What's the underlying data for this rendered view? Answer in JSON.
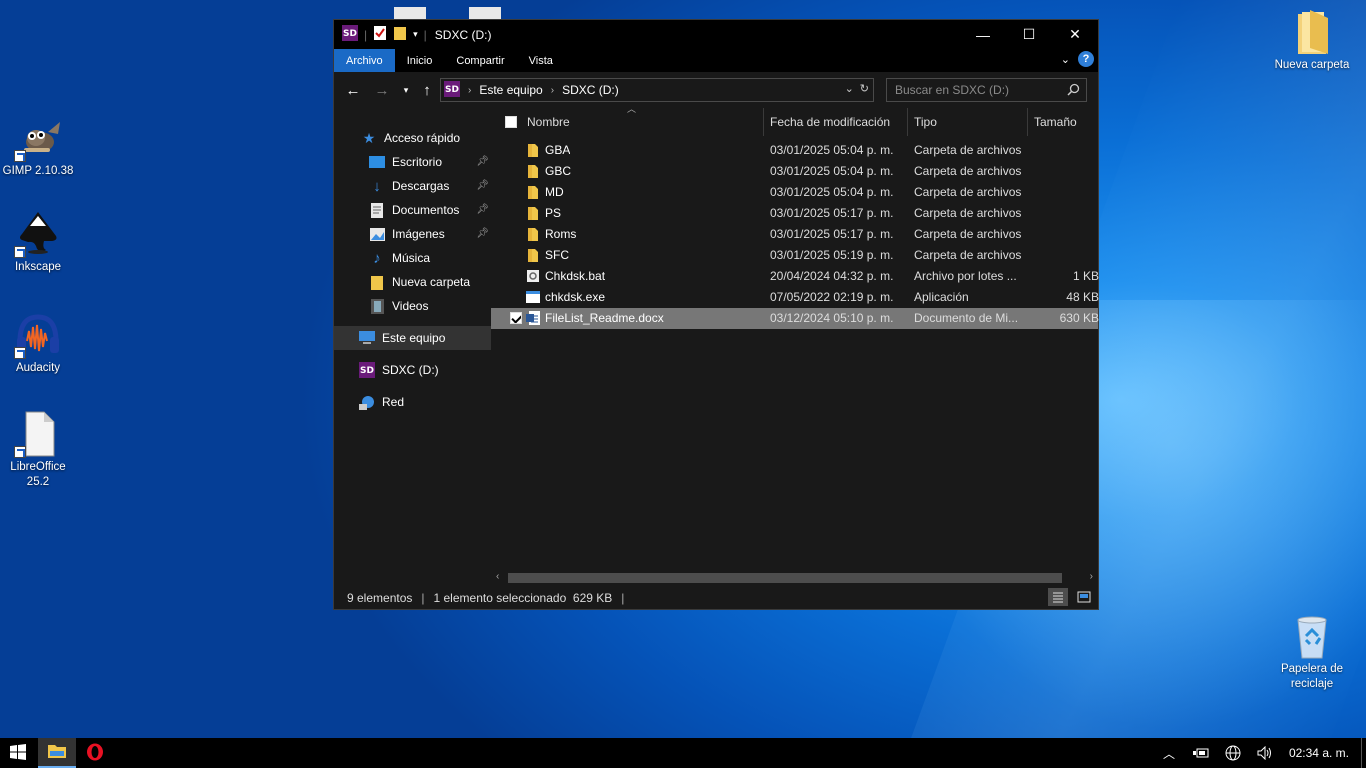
{
  "desktop": {
    "icons": [
      {
        "label": "GIMP 2.10.38",
        "icon": "gimp-icon"
      },
      {
        "label": "Inkscape",
        "icon": "inkscape-icon"
      },
      {
        "label": "Audacity",
        "icon": "audacity-icon"
      },
      {
        "label": "LibreOffice 25.2",
        "icon": "libreoffice-icon"
      },
      {
        "label": "Nueva carpeta",
        "icon": "folder-icon"
      },
      {
        "label": "Papelera de reciclaje",
        "icon": "recycle-bin-icon"
      }
    ]
  },
  "window": {
    "title": "SDXC (D:)",
    "controls": {
      "minimize": "—",
      "maximize": "☐",
      "close": "✕"
    },
    "ribbon_tabs": [
      "Archivo",
      "Inicio",
      "Compartir",
      "Vista"
    ],
    "address": {
      "crumbs": [
        "Este equipo",
        "SDXC (D:)"
      ]
    },
    "search": {
      "placeholder": "Buscar en SDXC (D:)"
    },
    "nav": {
      "quick_access": "Acceso rápido",
      "items": [
        "Escritorio",
        "Descargas",
        "Documentos",
        "Imágenes",
        "Música",
        "Nueva carpeta",
        "Videos"
      ],
      "this_pc": "Este equipo",
      "drive": "SDXC (D:)",
      "network": "Red"
    },
    "columns": {
      "name": "Nombre",
      "date": "Fecha de modificación",
      "type": "Tipo",
      "size": "Tamaño"
    },
    "files": [
      {
        "name": "GBA",
        "date": "03/01/2025 05:04 p. m.",
        "type": "Carpeta de archivos",
        "size": "",
        "icon": "folder-icon"
      },
      {
        "name": "GBC",
        "date": "03/01/2025 05:04 p. m.",
        "type": "Carpeta de archivos",
        "size": "",
        "icon": "folder-icon"
      },
      {
        "name": "MD",
        "date": "03/01/2025 05:04 p. m.",
        "type": "Carpeta de archivos",
        "size": "",
        "icon": "folder-icon"
      },
      {
        "name": "PS",
        "date": "03/01/2025 05:17 p. m.",
        "type": "Carpeta de archivos",
        "size": "",
        "icon": "folder-icon"
      },
      {
        "name": "Roms",
        "date": "03/01/2025 05:17 p. m.",
        "type": "Carpeta de archivos",
        "size": "",
        "icon": "folder-icon"
      },
      {
        "name": "SFC",
        "date": "03/01/2025 05:19 p. m.",
        "type": "Carpeta de archivos",
        "size": "",
        "icon": "folder-icon"
      },
      {
        "name": "Chkdsk.bat",
        "date": "20/04/2024 04:32 p. m.",
        "type": "Archivo por lotes ...",
        "size": "1 KB",
        "icon": "batch-file-icon"
      },
      {
        "name": "chkdsk.exe",
        "date": "07/05/2022 02:19 p. m.",
        "type": "Aplicación",
        "size": "48 KB",
        "icon": "exe-file-icon"
      },
      {
        "name": "FileList_Readme.docx",
        "date": "03/12/2024 05:10 p. m.",
        "type": "Documento de Mi...",
        "size": "630 KB",
        "icon": "word-doc-icon",
        "selected": true
      }
    ],
    "status": {
      "count": "9 elementos",
      "selection": "1 elemento seleccionado  629 KB"
    }
  },
  "taskbar": {
    "clock": "02:34 a. m.",
    "apps": [
      "file-explorer-icon",
      "opera-icon"
    ]
  },
  "colors": {
    "accent": "#1a6ac6",
    "folder": "#f0c64a",
    "window_bg": "#191919",
    "selected_row": "#777777"
  }
}
